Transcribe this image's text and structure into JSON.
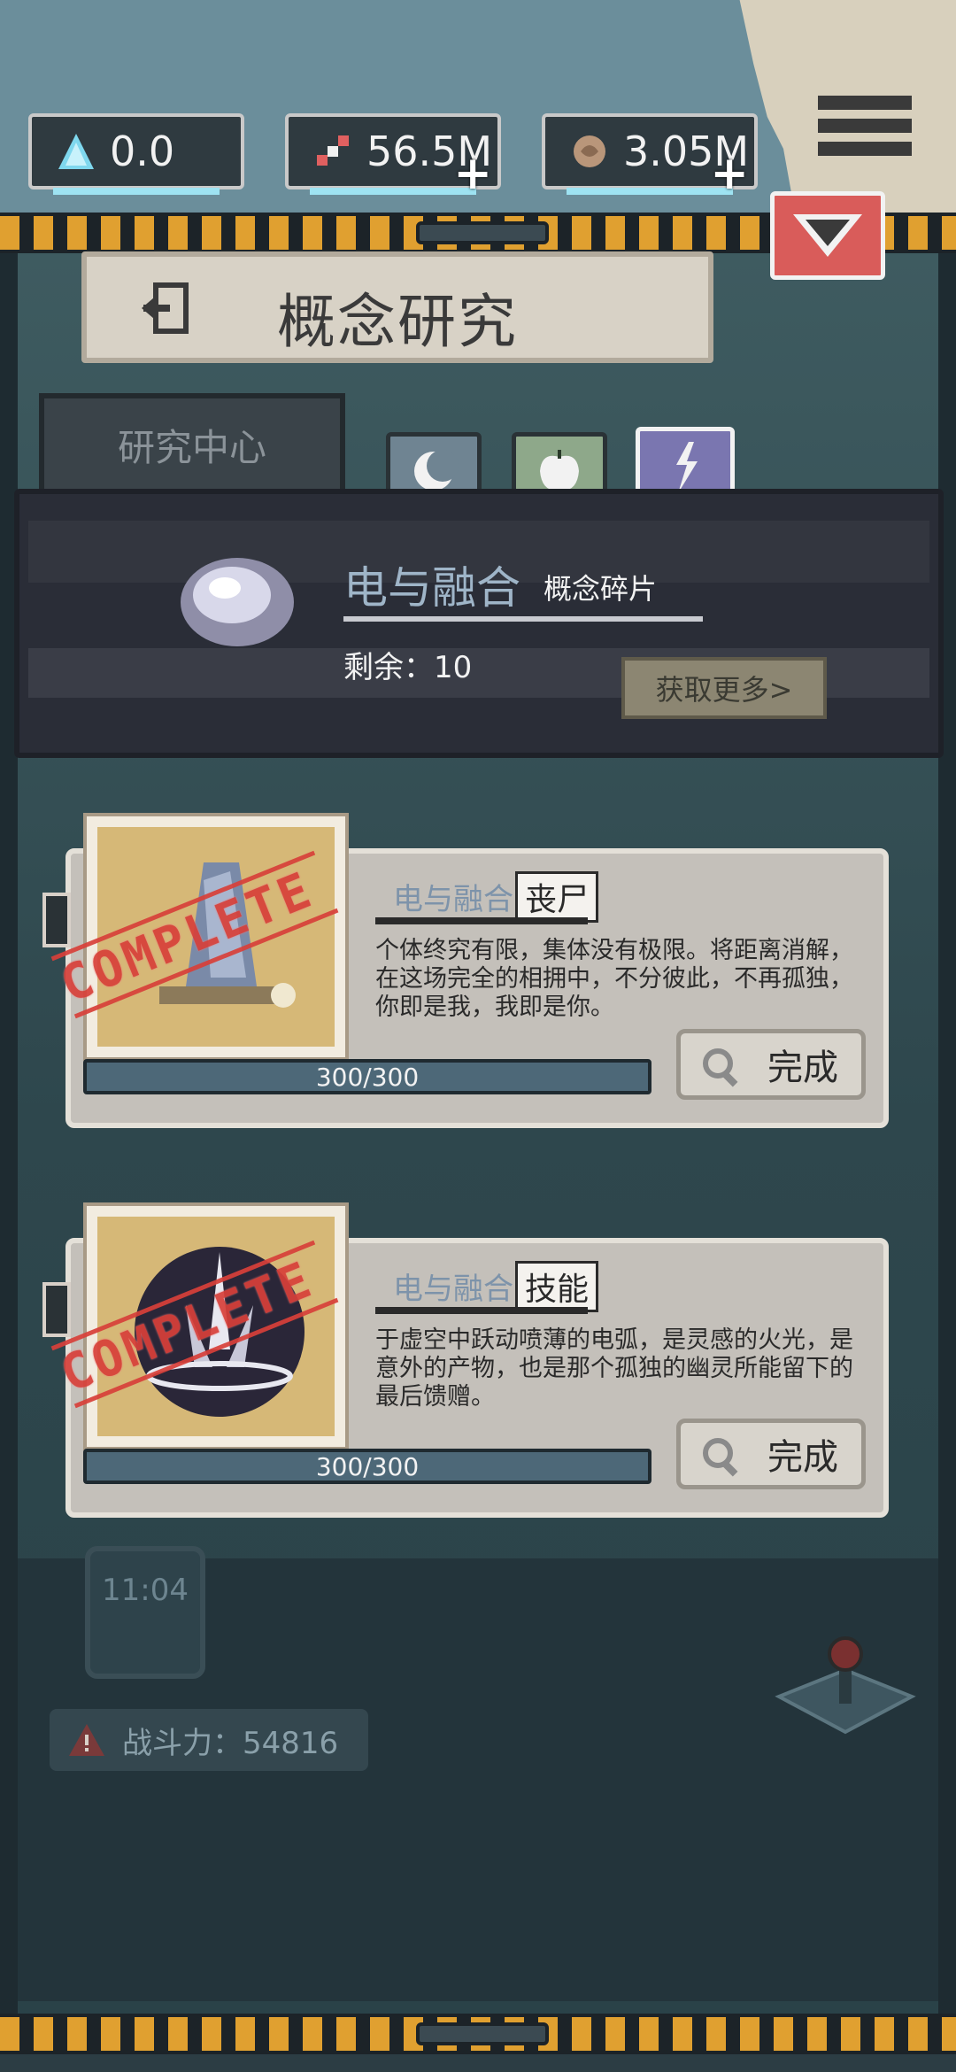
{
  "resources": {
    "crystal": {
      "icon": "crystal-icon",
      "value": "0.0"
    },
    "dna": {
      "icon": "dna-icon",
      "value": "56.5M",
      "add": "+"
    },
    "brain": {
      "icon": "brain-icon",
      "value": "3.05M",
      "add": "+"
    }
  },
  "header": {
    "title": "概念研究",
    "back_icon": "exit-icon"
  },
  "tabs": {
    "research_center": "研究中心",
    "icons": [
      "moon-icon",
      "apple-icon",
      "spark-icon"
    ],
    "selected": 2
  },
  "fragment": {
    "name": "电与融合",
    "kind": "概念碎片",
    "remaining": "剩余：10",
    "get_more": "获取更多>"
  },
  "cards": [
    {
      "stamp": "COMPLETE",
      "category": "电与融合",
      "tag": "丧尸",
      "desc": "个体终究有限，集体没有极限。将距离消解，在这场完全的相拥中，不分彼此，不再孤独，你即是我，我即是你。",
      "progress": "300/300",
      "progress_fraction": 1.0,
      "button": "完成"
    },
    {
      "stamp": "COMPLETE",
      "category": "电与融合",
      "tag": "技能",
      "desc": "于虚空中跃动喷薄的电弧，是灵感的火光，是意外的产物，也是那个孤独的幽灵所能留下的最后馈赠。",
      "progress": "300/300",
      "progress_fraction": 1.0,
      "button": "完成"
    }
  ],
  "background": {
    "clock": "11:04",
    "power": "战斗力：54816"
  },
  "colors": {
    "accent_red": "#d95c5a",
    "hazard_orange": "#e0a030",
    "progress_blue": "#4d6878",
    "category_blue": "#7d93aa"
  }
}
